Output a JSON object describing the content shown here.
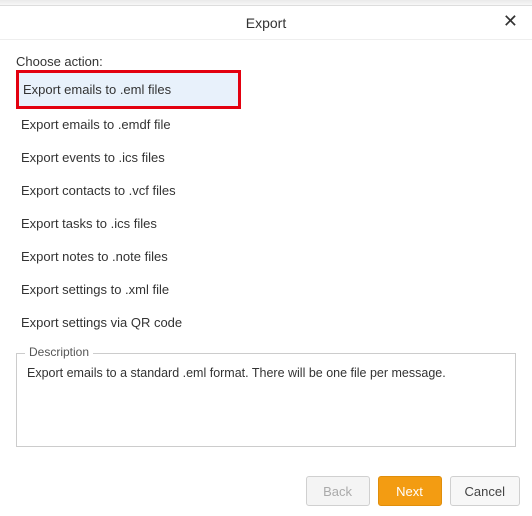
{
  "dialog": {
    "title": "Export",
    "close_symbol": "✕"
  },
  "choose_action_label": "Choose action:",
  "actions": [
    {
      "label": "Export emails to .eml files",
      "selected": true,
      "highlighted": true
    },
    {
      "label": "Export emails to .emdf file",
      "selected": false,
      "highlighted": false
    },
    {
      "label": "Export events to .ics files",
      "selected": false,
      "highlighted": false
    },
    {
      "label": "Export contacts to .vcf files",
      "selected": false,
      "highlighted": false
    },
    {
      "label": "Export tasks to .ics files",
      "selected": false,
      "highlighted": false
    },
    {
      "label": "Export notes to .note files",
      "selected": false,
      "highlighted": false
    },
    {
      "label": "Export settings to .xml file",
      "selected": false,
      "highlighted": false
    },
    {
      "label": "Export settings via QR code",
      "selected": false,
      "highlighted": false
    }
  ],
  "description": {
    "legend": "Description",
    "text": "Export emails to a standard .eml format. There will be one file per message."
  },
  "buttons": {
    "back": "Back",
    "next": "Next",
    "cancel": "Cancel"
  }
}
